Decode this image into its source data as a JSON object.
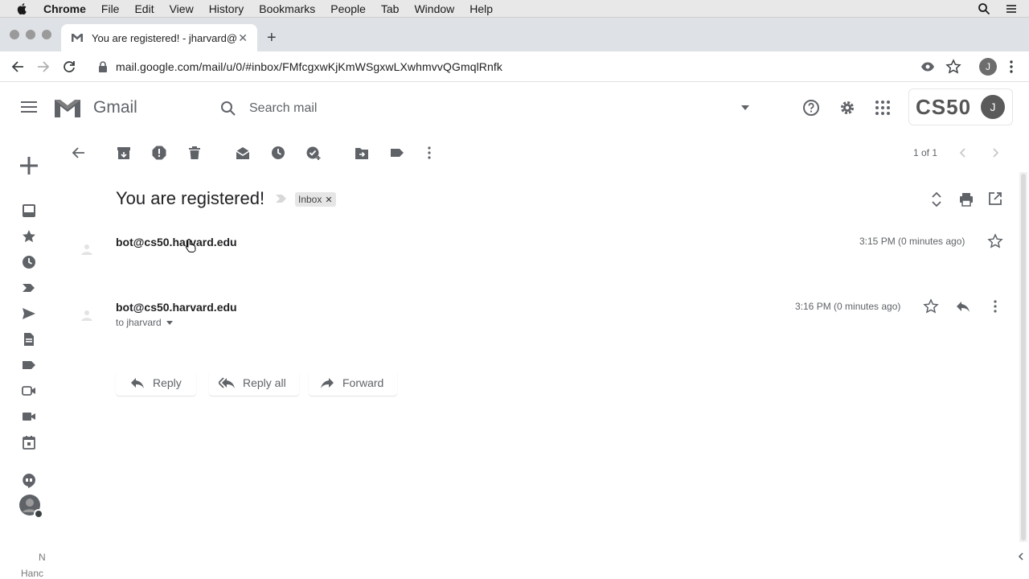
{
  "menubar": {
    "items": [
      "Chrome",
      "File",
      "Edit",
      "View",
      "History",
      "Bookmarks",
      "People",
      "Tab",
      "Window",
      "Help"
    ]
  },
  "browser": {
    "tab_title": "You are registered! - jharvard@",
    "url": "mail.google.com/mail/u/0/#inbox/FMfcgxwKjKmWSgxwLXwhmvvQGmqlRnfk",
    "profile_initial": "J"
  },
  "gmail": {
    "logo_text": "Gmail",
    "search_placeholder": "Search mail",
    "brand": "CS50",
    "account_initial": "J"
  },
  "message_toolbar": {
    "pager": "1 of 1"
  },
  "thread": {
    "subject": "You are registered!",
    "label": "Inbox",
    "messages": [
      {
        "sender": "bot@cs50.harvard.edu",
        "date": "3:15 PM (0 minutes ago)"
      },
      {
        "sender": "bot@cs50.harvard.edu",
        "date": "3:16 PM (0 minutes ago)",
        "to": "to jharvard"
      }
    ]
  },
  "actions": {
    "reply": "Reply",
    "reply_all": "Reply all",
    "forward": "Forward"
  },
  "sidebar_footer": {
    "line1": "N",
    "line2": "Hanc"
  },
  "colors": {
    "gmail_red": "#d93025",
    "icon_gray": "#5f6368",
    "chrome_frame": "#dee1e6"
  }
}
